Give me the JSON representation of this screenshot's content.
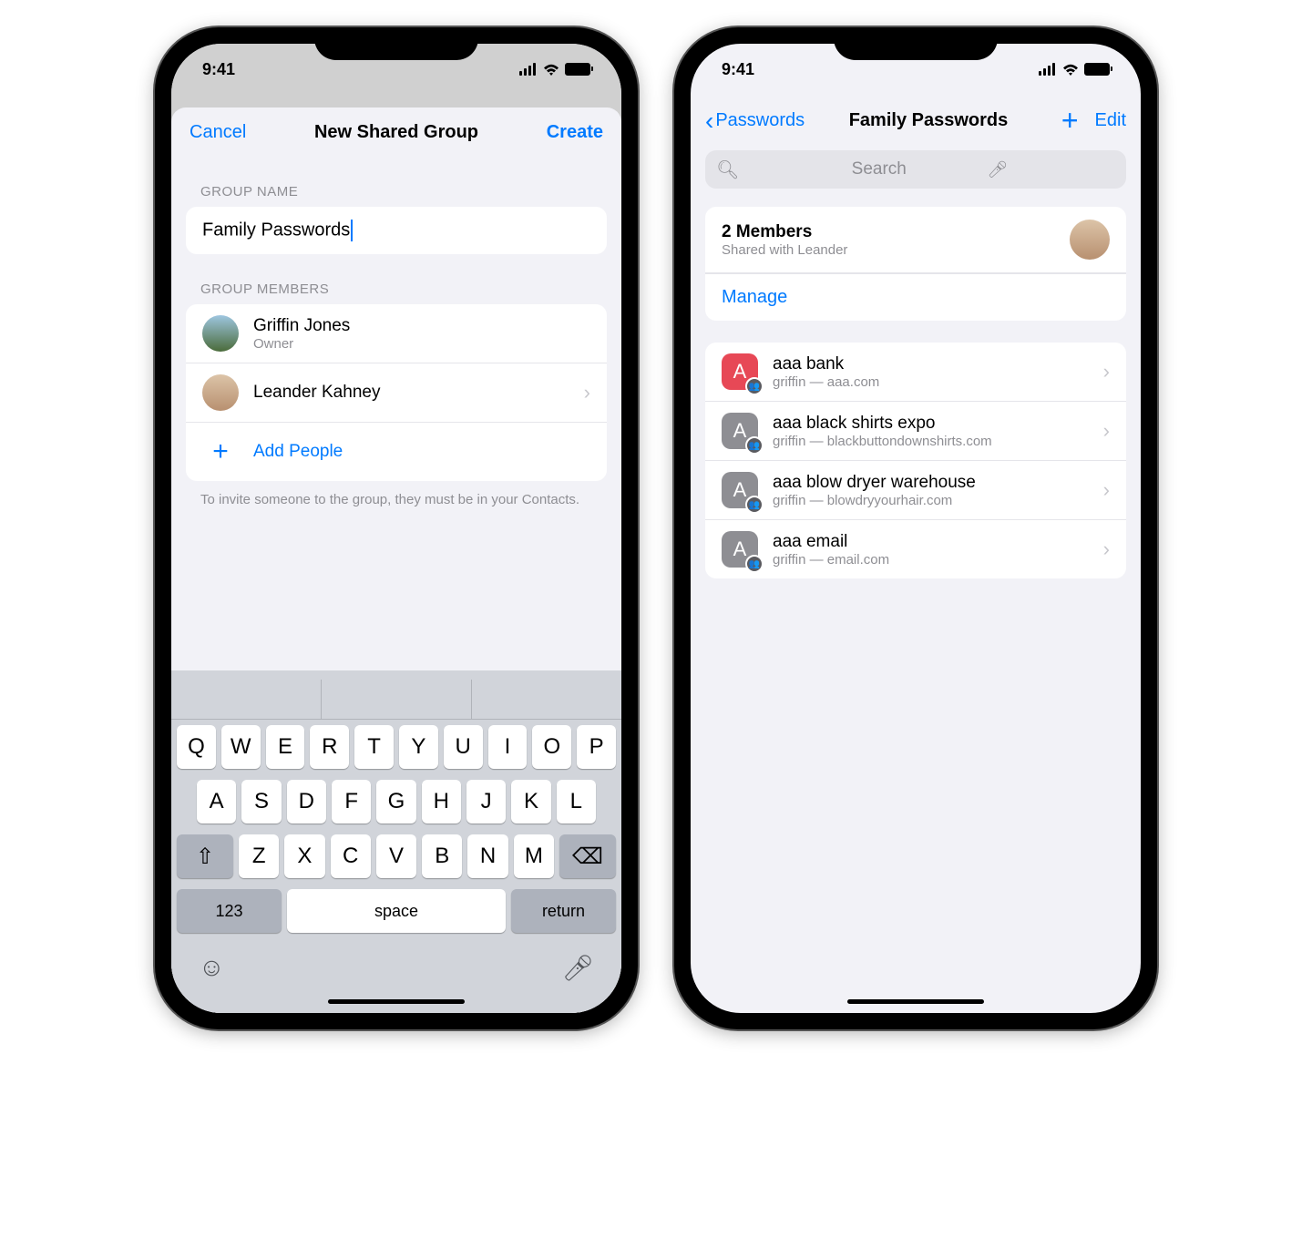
{
  "status": {
    "time": "9:41"
  },
  "left": {
    "nav": {
      "cancel": "Cancel",
      "title": "New Shared Group",
      "create": "Create"
    },
    "section_group_name": "GROUP NAME",
    "group_name_value": "Family Passwords",
    "section_members": "GROUP MEMBERS",
    "members": [
      {
        "name": "Griffin Jones",
        "role": "Owner"
      },
      {
        "name": "Leander Kahney",
        "role": ""
      }
    ],
    "add_people": "Add People",
    "footnote": "To invite someone to the group, they must be in your Contacts.",
    "keyboard": {
      "row1": [
        "Q",
        "W",
        "E",
        "R",
        "T",
        "Y",
        "U",
        "I",
        "O",
        "P"
      ],
      "row2": [
        "A",
        "S",
        "D",
        "F",
        "G",
        "H",
        "J",
        "K",
        "L"
      ],
      "row3": [
        "Z",
        "X",
        "C",
        "V",
        "B",
        "N",
        "M"
      ],
      "num": "123",
      "space": "space",
      "return": "return"
    }
  },
  "right": {
    "nav": {
      "back": "Passwords",
      "title": "Family Passwords",
      "edit": "Edit"
    },
    "search_placeholder": "Search",
    "members": {
      "title": "2 Members",
      "subtitle": "Shared with Leander",
      "manage": "Manage"
    },
    "passwords": [
      {
        "title": "aaa bank",
        "subtitle": "griffin — aaa.com",
        "color": "red"
      },
      {
        "title": "aaa black shirts expo",
        "subtitle": "griffin — blackbuttondownshirts.com",
        "color": "gray"
      },
      {
        "title": "aaa blow dryer warehouse",
        "subtitle": "griffin — blowdryyourhair.com",
        "color": "gray"
      },
      {
        "title": "aaa email",
        "subtitle": "griffin — email.com",
        "color": "gray"
      }
    ]
  }
}
